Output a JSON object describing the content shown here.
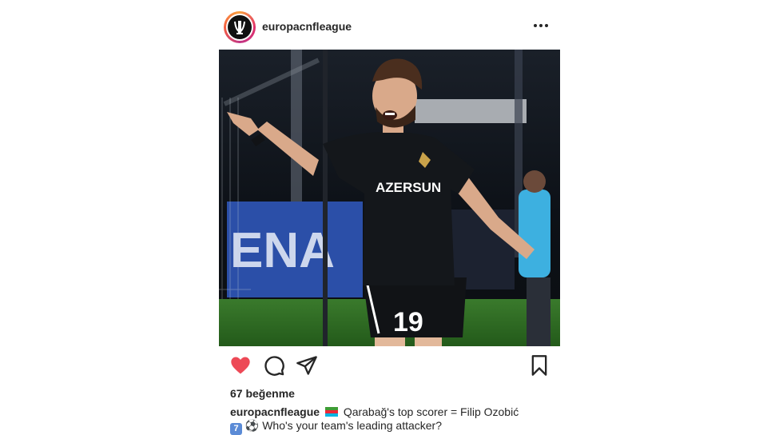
{
  "post": {
    "username": "europacnfleague",
    "image": {
      "sponsor_text": "AZERSUN",
      "shirt_number": "19",
      "board_text": "ENA"
    },
    "likes_text": "67 beğenme",
    "caption": {
      "username": "europacnfleague",
      "flag_emoji": "🇦🇿",
      "text_line1": "Qarabağ's top scorer = Filip Ozobić",
      "keycap": "7",
      "ball_emoji": "⚽",
      "text_line2": "Who's your team's leading attacker?"
    }
  },
  "icons": {
    "more": "more-options-icon",
    "like": "heart-icon",
    "comment": "comment-icon",
    "share": "send-icon",
    "save": "bookmark-icon"
  },
  "colors": {
    "heart": "#ed4956",
    "text": "#262626"
  }
}
